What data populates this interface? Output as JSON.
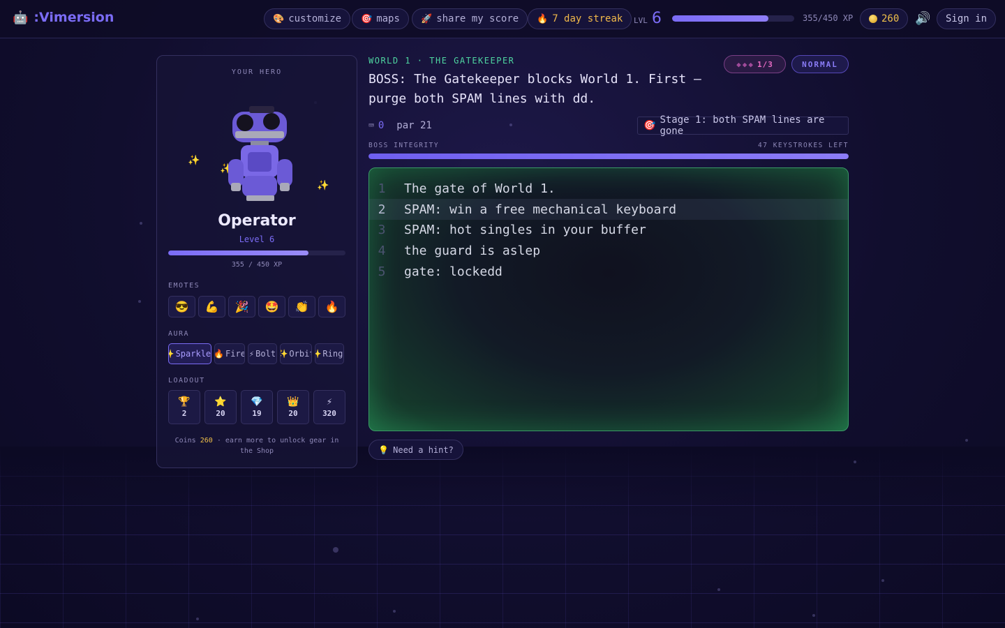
{
  "app": {
    "title": ":Vimersion"
  },
  "nav": {
    "customize": "customize",
    "maps": "maps",
    "share": "share my score",
    "streak": "7 day streak",
    "level_label": "LVL",
    "level": "6",
    "xp_text": "355/450 XP",
    "xp_progress": 0.79,
    "coins": "260",
    "sign_in": "Sign in"
  },
  "hero": {
    "title": "YOUR HERO",
    "name": "Operator",
    "level": "Level 6",
    "xp_text": "355 / 450 XP",
    "xp_progress": 0.79,
    "emotes_label": "EMOTES",
    "emotes": [
      "😎",
      "💪",
      "🎉",
      "🤩",
      "👏",
      "🔥"
    ],
    "aura_label": "AURA",
    "auras": [
      {
        "icon": "✨",
        "label": "Sparkles",
        "active": true
      },
      {
        "icon": "🔥",
        "label": "Fire"
      },
      {
        "icon": "⚡",
        "label": "Bolt"
      },
      {
        "icon": "✨",
        "label": "Orbit"
      },
      {
        "icon": "✨",
        "label": "Rings"
      }
    ],
    "loadout_label": "LOADOUT",
    "loadout": [
      {
        "icon": "🏆",
        "value": "2"
      },
      {
        "icon": "⭐",
        "value": "20"
      },
      {
        "icon": "💎",
        "value": "19"
      },
      {
        "icon": "👑",
        "value": "20"
      },
      {
        "icon": "⚡",
        "value": "320"
      }
    ],
    "coins_note_prefix": "Coins",
    "coins_note_amount": "260",
    "coins_note_suffix": "· earn more to unlock gear in the Shop"
  },
  "boss": {
    "world": "WORLD 1 · THE GATEKEEPER",
    "text": "BOSS: The Gatekeeper blocks World 1. First — purge both SPAM lines with dd.",
    "stage": "1/3",
    "difficulty": "NORMAL",
    "keystrokes": "0",
    "par": "par 21",
    "objective": "Stage 1: both SPAM lines are gone",
    "integrity_label": "BOSS INTEGRITY",
    "keystrokes_left": "47 KEYSTROKES LEFT",
    "integrity": 1.0
  },
  "editor": {
    "active_line": 2,
    "lines": [
      "The gate of World 1.",
      "SPAM: win a free mechanical keyboard",
      "SPAM: hot singles in your buffer",
      "the guard is aslep",
      "gate: lockedd"
    ]
  },
  "hint": "Need a hint?"
}
